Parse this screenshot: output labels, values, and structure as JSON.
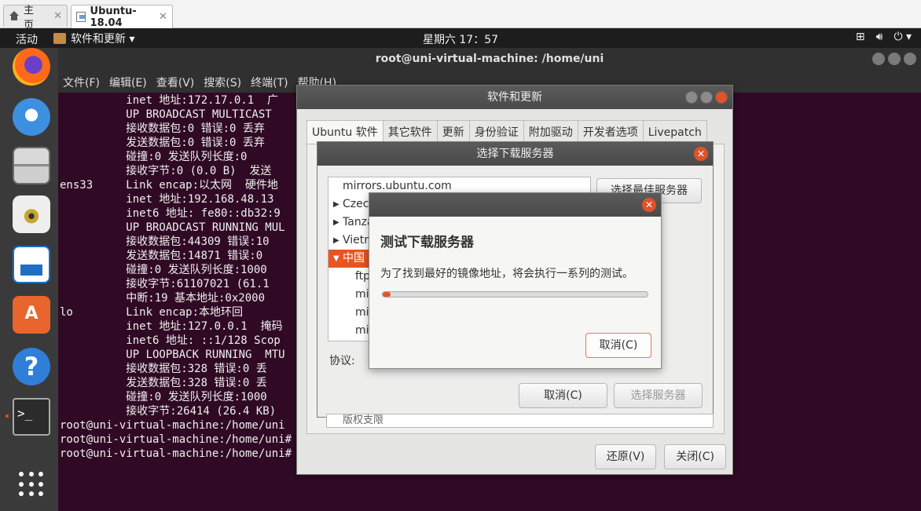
{
  "host_tabs": [
    {
      "label": "主页",
      "icon": "home-icon"
    },
    {
      "label": "Ubuntu-18.04",
      "icon": "vm-icon"
    }
  ],
  "panel": {
    "activities": "活动",
    "app_menu": "软件和更新 ▾",
    "clock": "星期六 17：57",
    "tray_icons": [
      "network-icon",
      "volume-icon",
      "power-icon"
    ]
  },
  "dock_items": [
    "firefox-icon",
    "thunderbird-icon",
    "files-icon",
    "rhythmbox-icon",
    "writer-icon",
    "software-center-icon",
    "help-icon",
    "terminal-icon",
    "show-apps-icon"
  ],
  "terminal": {
    "title": "root@uni-virtual-machine: /home/uni",
    "menu": [
      "文件(F)",
      "编辑(E)",
      "查看(V)",
      "搜索(S)",
      "终端(T)",
      "帮助(H)"
    ],
    "lines": [
      "          inet 地址:172.17.0.1  广",
      "          UP BROADCAST MULTICAST",
      "          接收数据包:0 错误:0 丢弃",
      "          发送数据包:0 错误:0 丢弃",
      "          碰撞:0 发送队列长度:0",
      "          接收字节:0 (0.0 B)  发送",
      "",
      "ens33     Link encap:以太网  硬件地",
      "          inet 地址:192.168.48.13",
      "          inet6 地址: fe80::db32:9",
      "          UP BROADCAST RUNNING MUL",
      "          接收数据包:44309 错误:10",
      "          发送数据包:14871 错误:0",
      "          碰撞:0 发送队列长度:1000",
      "          接收字节:61107021 (61.1",
      "          中断:19 基本地址:0x2000",
      "",
      "lo        Link encap:本地环回",
      "          inet 地址:127.0.0.1  掩码",
      "          inet6 地址: ::1/128 Scop",
      "          UP LOOPBACK RUNNING  MTU",
      "          接收数据包:328 错误:0 丢",
      "          发送数据包:328 错误:0 丢",
      "          碰撞:0 发送队列长度:1000",
      "          接收字节:26414 (26.4 KB)",
      "",
      "root@uni-virtual-machine:/home/uni",
      "root@uni-virtual-machine:/home/uni# sudo nano /etc/apt/source.list",
      "root@uni-virtual-machine:/home/uni# "
    ]
  },
  "swu": {
    "title": "软件和更新",
    "tabs": [
      "Ubuntu 软件",
      "其它软件",
      "更新",
      "身份验证",
      "附加驱动",
      "开发者选项",
      "Livepatch"
    ],
    "revert": "还原(V)",
    "close": "关闭(C)"
  },
  "chooser": {
    "title": "选择下载服务器",
    "best_button": "选择最佳服务器(S)",
    "rows": [
      {
        "label": "mirrors.ubuntu.com",
        "type": "plain"
      },
      {
        "label": "Czech",
        "type": "collapsed"
      },
      {
        "label": "Tanza",
        "type": "collapsed"
      },
      {
        "label": "Vietn",
        "type": "collapsed"
      },
      {
        "label": "中国",
        "type": "expanded-selected"
      },
      {
        "label": "ftp",
        "type": "child"
      },
      {
        "label": "mi",
        "type": "child"
      },
      {
        "label": "mi",
        "type": "child"
      },
      {
        "label": "mi",
        "type": "child"
      }
    ],
    "protocol_label": "协议:",
    "cancel": "取消(C)",
    "select": "选择服务器(S)",
    "footer": "版权支限"
  },
  "test_dialog": {
    "heading": "测试下载服务器",
    "message": "为了找到最好的镜像地址，将会执行一系列的测试。",
    "progress": 0.03,
    "cancel": "取消(C)"
  },
  "colors": {
    "accent": "#e95420",
    "terminal_bg": "#300a24"
  }
}
